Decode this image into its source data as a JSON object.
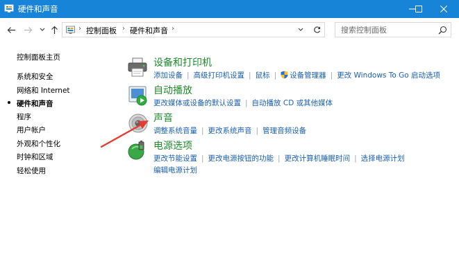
{
  "window": {
    "title": "硬件和声音",
    "icons": {
      "app": "control-panel-icon",
      "minimize": "minimize-icon",
      "maximize": "maximize-icon",
      "close": "close-icon"
    }
  },
  "nav": {
    "breadcrumb": [
      "控制面板",
      "硬件和声音"
    ],
    "separator": "›",
    "search_placeholder": "搜索控制面板"
  },
  "sidebar": {
    "items": [
      {
        "label": "控制面板主页",
        "active": false
      },
      {
        "label": "系统和安全",
        "active": false
      },
      {
        "label": "网络和 Internet",
        "active": false
      },
      {
        "label": "硬件和声音",
        "active": true
      },
      {
        "label": "程序",
        "active": false
      },
      {
        "label": "用户帐户",
        "active": false
      },
      {
        "label": "外观和个性化",
        "active": false
      },
      {
        "label": "时钟和区域",
        "active": false
      },
      {
        "label": "轻松使用",
        "active": false
      }
    ]
  },
  "categories": [
    {
      "title": "设备和打印机",
      "icon": "printer-icon",
      "links": [
        "添加设备",
        "高级打印机设置",
        "鼠标",
        "设备管理器",
        "更改 Windows To Go 启动选项"
      ]
    },
    {
      "title": "自动播放",
      "icon": "autoplay-icon",
      "links": [
        "更改媒体或设备的默认设置",
        "自动播放 CD 或其他媒体"
      ]
    },
    {
      "title": "声音",
      "icon": "speaker-icon",
      "links": [
        "调整系统音量",
        "更改系统声音",
        "管理音频设备"
      ]
    },
    {
      "title": "电源选项",
      "icon": "battery-icon",
      "links": [
        "更改节能设置",
        "更改电源按钮的功能",
        "更改计算机睡眠时间",
        "选择电源计划",
        "编辑电源计划"
      ]
    }
  ],
  "colors": {
    "titlebar": "#1884d8",
    "category_title": "#1e8b2c",
    "link": "#1a5fb4",
    "annotation_arrow": "#e53a2f"
  }
}
